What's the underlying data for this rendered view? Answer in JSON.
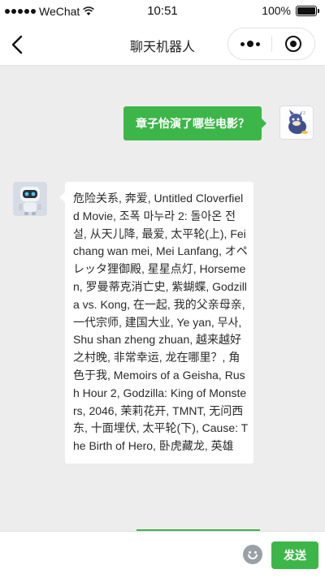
{
  "status_bar": {
    "carrier": "WeChat",
    "time": "10:51",
    "battery_text": "100%"
  },
  "nav": {
    "title": "聊天机器人",
    "back_icon": "chevron-left-icon",
    "more_icon": "more-dots-icon",
    "close_icon": "target-close-icon"
  },
  "messages": [
    {
      "from": "user",
      "text": "章子怡演了哪些电影？"
    },
    {
      "from": "bot",
      "text": "危险关系, 奔爱, Untitled Cloverfield Movie, 조폭 마누라 2: 돌아온 전설, 从天儿降, 最爱, 太平轮(上), Fei chang wan mei, Mei Lanfang, オペレッタ狸御殿, 星星点灯, Horsemen, 罗曼蒂克消亡史, 紫蝴蝶, Godzilla vs. Kong, 在一起, 我的父亲母亲, 一代宗师, 建国大业, Ye yan, 무사, Shu shan zheng zhuan, 越来越好之村晚, 非常幸运, 龙在哪里？, 角色于我, Memoirs of a Geisha, Rush Hour 2, Godzilla: King of Monsters, 2046, 茉莉花开, TMNT, 无问西东, 十面埋伏, 太平轮(下), Cause: The Birth of Hero, 卧虎藏龙, 英雄"
    }
  ],
  "input": {
    "value": "",
    "placeholder": "",
    "send_label": "发送",
    "emoji_icon": "emoji-icon"
  },
  "colors": {
    "accent": "#3db649",
    "background": "#ededed",
    "bubble_bot": "#ffffff"
  }
}
